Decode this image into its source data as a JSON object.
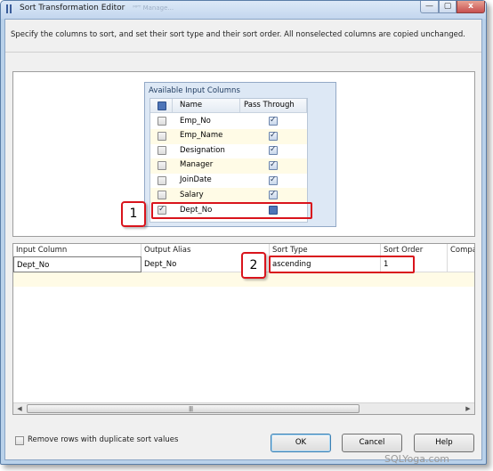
{
  "window": {
    "title": "Sort Transformation Editor",
    "title_blur": "ᴹᴾᵀ Manage..."
  },
  "description": "Specify the columns to sort, and set their sort type and their sort order. All nonselected columns are copied unchanged.",
  "available_columns": {
    "title": "Available Input Columns",
    "headers": {
      "name": "Name",
      "pass_through": "Pass Through"
    },
    "rows": [
      {
        "name": "Emp_No",
        "selected": false,
        "pass_through": true
      },
      {
        "name": "Emp_Name",
        "selected": false,
        "pass_through": true
      },
      {
        "name": "Designation",
        "selected": false,
        "pass_through": true
      },
      {
        "name": "Manager",
        "selected": false,
        "pass_through": true
      },
      {
        "name": "JoinDate",
        "selected": false,
        "pass_through": true
      },
      {
        "name": "Salary",
        "selected": false,
        "pass_through": true
      },
      {
        "name": "Dept_No",
        "selected": true,
        "pass_through": false
      }
    ]
  },
  "sort_grid": {
    "headers": [
      "Input Column",
      "Output Alias",
      "Sort Type",
      "Sort Order",
      "Compar"
    ],
    "rows": [
      {
        "input_column": "Dept_No",
        "output_alias": "Dept_No",
        "sort_type": "ascending",
        "sort_order": "1",
        "comparison": ""
      }
    ]
  },
  "markers": {
    "one": "1",
    "two": "2"
  },
  "remove_duplicates_label": "Remove rows with duplicate sort values",
  "buttons": {
    "ok": "OK",
    "cancel": "Cancel",
    "help": "Help"
  },
  "caption_buttons": {
    "minimize": "—",
    "maximize": "▢",
    "close": "x"
  },
  "watermark": "SQLYoga.com",
  "colors": {
    "highlight": "#d9141c",
    "alt_row": "#fffbe6",
    "frame": "#b9d1ea"
  }
}
